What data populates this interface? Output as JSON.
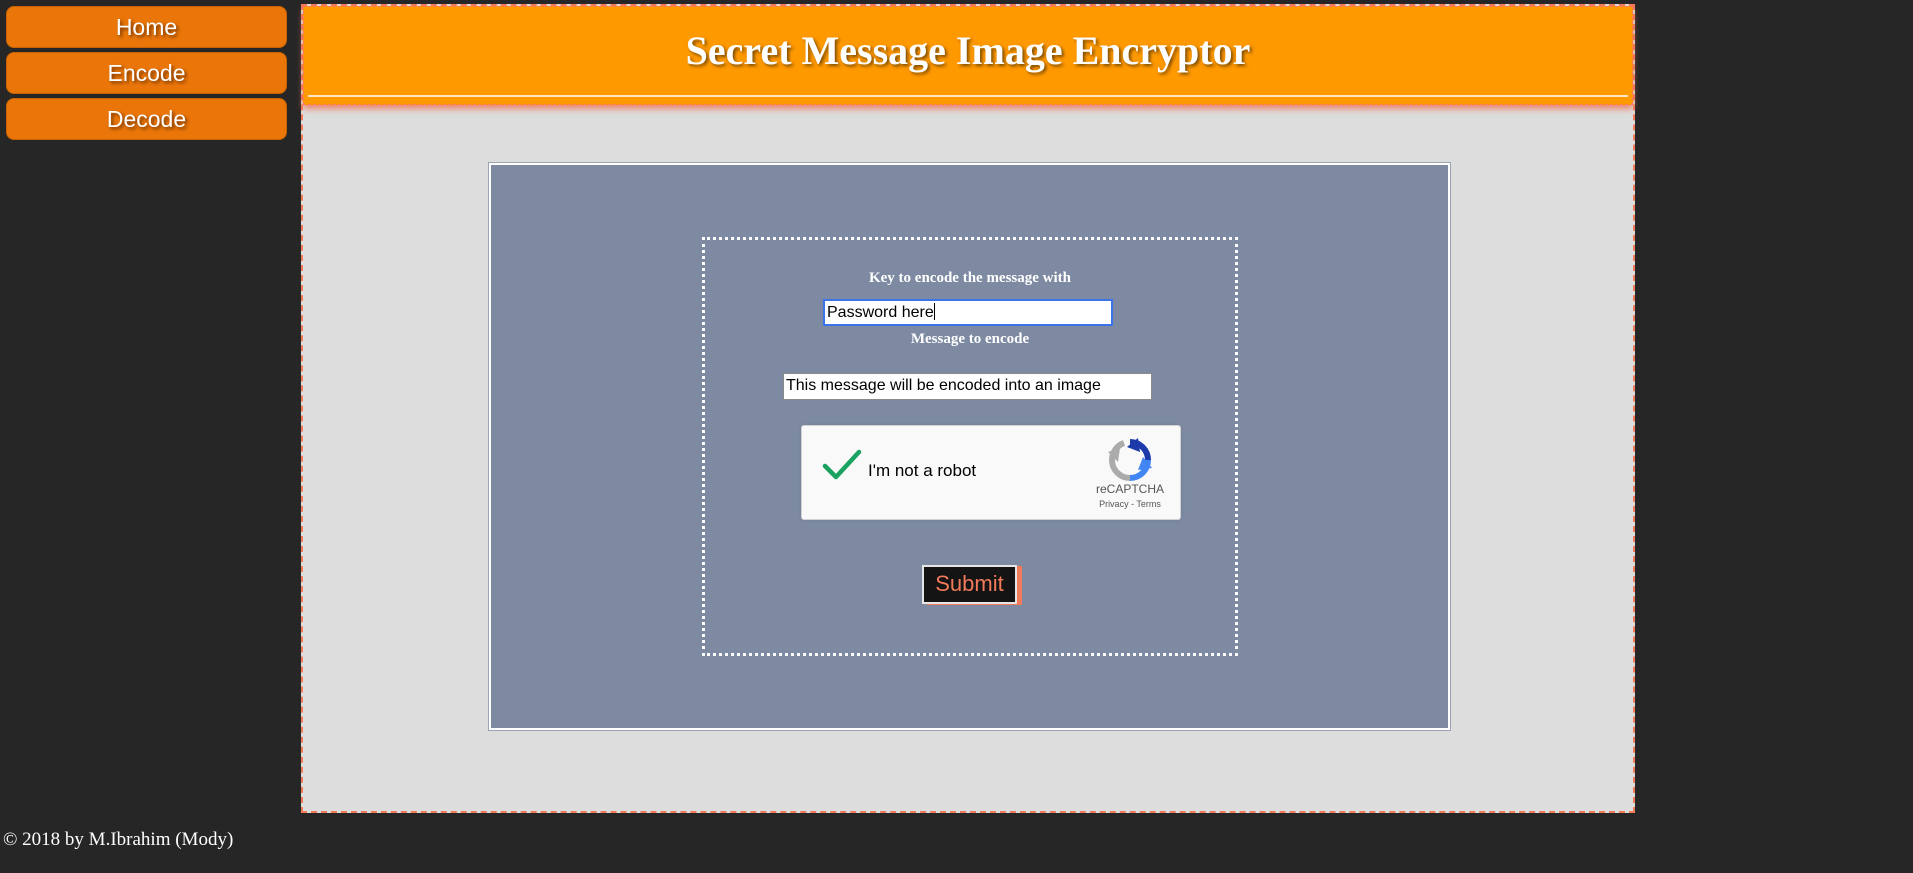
{
  "nav": {
    "items": [
      {
        "label": "Home"
      },
      {
        "label": "Encode"
      },
      {
        "label": "Decode"
      }
    ]
  },
  "header": {
    "title": "Secret Message Image Encryptor"
  },
  "form": {
    "key_label": "Key to encode the message with",
    "key_value": "Password here",
    "message_label": "Message to encode",
    "message_value": "This message will be encoded into an image",
    "submit_label": "Submit"
  },
  "recaptcha": {
    "checked": true,
    "label": "I'm not a robot",
    "brand": "reCAPTCHA",
    "privacy": "Privacy",
    "separator": " - ",
    "terms": "Terms",
    "check_color": "#1aa260"
  },
  "footer": {
    "text": "© 2018 by M.Ibrahim (Mody)"
  },
  "colors": {
    "background": "#262626",
    "nav_button": "#ea7609",
    "header": "#ff9900",
    "panel": "#dddddd",
    "card": "#7d8aa2",
    "accent": "#f07a5a"
  }
}
